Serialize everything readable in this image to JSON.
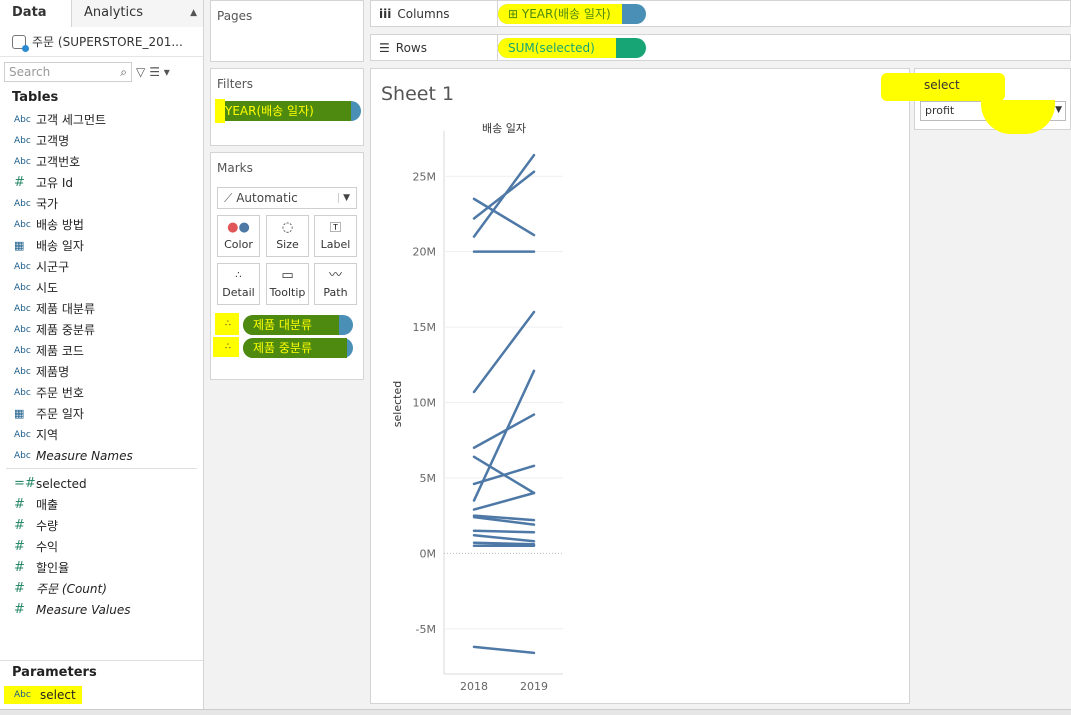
{
  "data_pane": {
    "tabs": [
      "Data",
      "Analytics"
    ],
    "datasource": "주문 (SUPERSTORE_201...",
    "search_placeholder": "Search",
    "tables_title": "Tables",
    "dimensions": [
      {
        "type": "Abc",
        "name": "고객 세그먼트"
      },
      {
        "type": "Abc",
        "name": "고객명"
      },
      {
        "type": "Abc",
        "name": "고객번호"
      },
      {
        "type": "#",
        "name": "고유 Id"
      },
      {
        "type": "Abc",
        "name": "국가"
      },
      {
        "type": "Abc",
        "name": "배송 방법"
      },
      {
        "type": "cal",
        "name": "배송 일자"
      },
      {
        "type": "Abc",
        "name": "시군구"
      },
      {
        "type": "Abc",
        "name": "시도"
      },
      {
        "type": "Abc",
        "name": "제품 대분류"
      },
      {
        "type": "Abc",
        "name": "제품 중분류"
      },
      {
        "type": "Abc",
        "name": "제품 코드"
      },
      {
        "type": "Abc",
        "name": "제품명"
      },
      {
        "type": "Abc",
        "name": "주문 번호"
      },
      {
        "type": "cal",
        "name": "주문 일자"
      },
      {
        "type": "Abc",
        "name": "지역"
      },
      {
        "type": "Abc",
        "name": "Measure Names",
        "italic": true
      }
    ],
    "measures": [
      {
        "type": "=#",
        "name": "selected"
      },
      {
        "type": "#",
        "name": "매출"
      },
      {
        "type": "#",
        "name": "수량"
      },
      {
        "type": "#",
        "name": "수익"
      },
      {
        "type": "#",
        "name": "할인율"
      },
      {
        "type": "#",
        "name": "주문 (Count)",
        "italic": true
      },
      {
        "type": "#",
        "name": "Measure Values",
        "italic": true
      }
    ],
    "parameters_title": "Parameters",
    "parameters": [
      {
        "type": "Abc",
        "name": "select"
      }
    ]
  },
  "pages": {
    "title": "Pages"
  },
  "filters": {
    "title": "Filters",
    "pills": [
      "YEAR(배송 일자)"
    ]
  },
  "marks": {
    "title": "Marks",
    "type": "Automatic",
    "buttons": [
      "Color",
      "Size",
      "Label",
      "Detail",
      "Tooltip",
      "Path"
    ],
    "detail_pills": [
      "제품 대분류",
      "제품 중분류"
    ]
  },
  "columns": {
    "label": "Columns",
    "pill": "YEAR(배송 일자)"
  },
  "rows": {
    "label": "Rows",
    "pill": "SUM(selected)"
  },
  "sheet": {
    "title": "Sheet 1"
  },
  "parameter_card": {
    "title": "select",
    "value": "profit"
  },
  "chart_data": {
    "type": "line",
    "title": "배송 일자",
    "ylabel": "selected",
    "x": [
      "2018",
      "2019"
    ],
    "yticks": [
      "25M",
      "20M",
      "15M",
      "10M",
      "5M",
      "0M",
      "-5M"
    ],
    "ylim": [
      -8000000,
      28000000
    ],
    "series": [
      {
        "values": [
          21000000,
          26400000
        ]
      },
      {
        "values": [
          22200000,
          25300000
        ]
      },
      {
        "values": [
          23500000,
          21100000
        ]
      },
      {
        "values": [
          20000000,
          20000000
        ]
      },
      {
        "values": [
          10700000,
          16000000
        ]
      },
      {
        "values": [
          3500000,
          12100000
        ]
      },
      {
        "values": [
          7000000,
          9200000
        ]
      },
      {
        "values": [
          6400000,
          4000000
        ]
      },
      {
        "values": [
          4600000,
          5800000
        ]
      },
      {
        "values": [
          2900000,
          4000000
        ]
      },
      {
        "values": [
          2500000,
          2200000
        ]
      },
      {
        "values": [
          2400000,
          1900000
        ]
      },
      {
        "values": [
          1500000,
          1400000
        ]
      },
      {
        "values": [
          1200000,
          800000
        ]
      },
      {
        "values": [
          700000,
          600000
        ]
      },
      {
        "values": [
          500000,
          500000
        ]
      },
      {
        "values": [
          -6200000,
          -6600000
        ]
      }
    ]
  }
}
